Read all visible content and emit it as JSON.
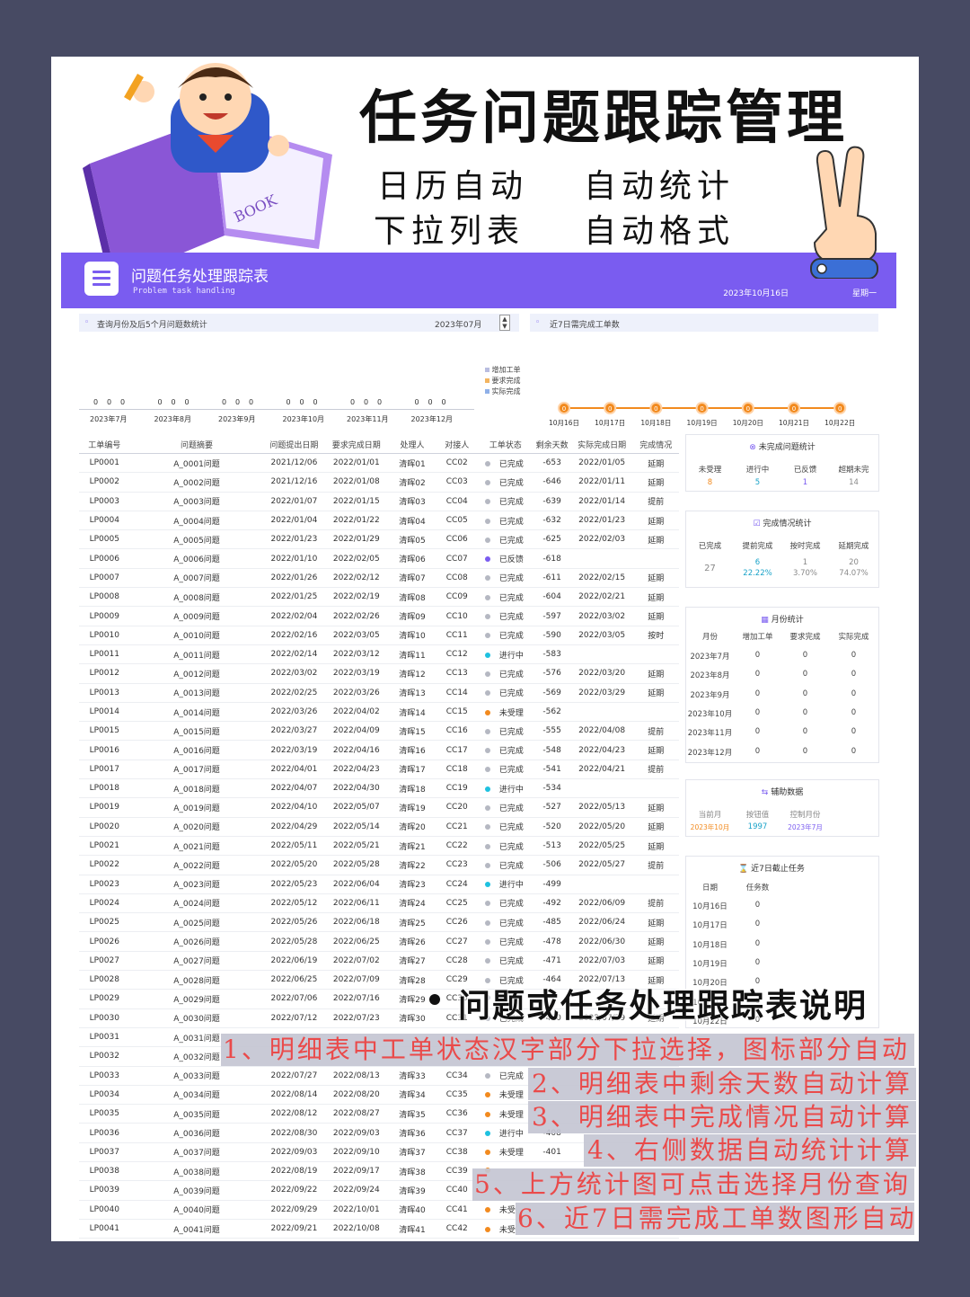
{
  "hero": {
    "title": "任务问题跟踪管理",
    "features": [
      "日历自动",
      "自动统计",
      "下拉列表",
      "自动格式"
    ]
  },
  "banner": {
    "title": "问题任务处理跟踪表",
    "subtitle": "Problem task handling",
    "date": "2023年10月16日",
    "weekday": "星期一"
  },
  "query": {
    "label": "查询月份及后5个月问题数统计",
    "month_value": "2023年07月",
    "next7_label": "近7日需完成工单数"
  },
  "legend": [
    "增加工单",
    "要求完成",
    "实际完成"
  ],
  "month_chart": {
    "months": [
      "2023年7月",
      "2023年8月",
      "2023年9月",
      "2023年10月",
      "2023年11月",
      "2023年12月"
    ],
    "values": [
      [
        0,
        0,
        0
      ],
      [
        0,
        0,
        0
      ],
      [
        0,
        0,
        0
      ],
      [
        0,
        0,
        0
      ],
      [
        0,
        0,
        0
      ],
      [
        0,
        0,
        0
      ]
    ]
  },
  "chart_data": {
    "type": "line",
    "categories": [
      "10月16日",
      "10月17日",
      "10月18日",
      "10月19日",
      "10月20日",
      "10月21日",
      "10月22日"
    ],
    "values": [
      0,
      0,
      0,
      0,
      0,
      0,
      0
    ]
  },
  "colors": {
    "purple": "#7a5cf0",
    "orange": "#f28a1e",
    "note_red": "#ea4a4a"
  },
  "table": {
    "headers": [
      "工单编号",
      "问题摘要",
      "问题提出日期",
      "要求完成日期",
      "处理人",
      "对接人",
      "工单状态",
      "剩余天数",
      "实际完成日期",
      "完成情况"
    ],
    "rows": [
      [
        "LP0001",
        "A_0001问题",
        "2021/12/06",
        "2022/01/01",
        "清晖01",
        "CC02",
        "gray",
        "已完成",
        "-653",
        "2022/01/05",
        "延期"
      ],
      [
        "LP0002",
        "A_0002问题",
        "2021/12/16",
        "2022/01/08",
        "清晖02",
        "CC03",
        "gray",
        "已完成",
        "-646",
        "2022/01/11",
        "延期"
      ],
      [
        "LP0003",
        "A_0003问题",
        "2022/01/07",
        "2022/01/15",
        "清晖03",
        "CC04",
        "gray",
        "已完成",
        "-639",
        "2022/01/14",
        "提前"
      ],
      [
        "LP0004",
        "A_0004问题",
        "2022/01/04",
        "2022/01/22",
        "清晖04",
        "CC05",
        "gray",
        "已完成",
        "-632",
        "2022/01/23",
        "延期"
      ],
      [
        "LP0005",
        "A_0005问题",
        "2022/01/23",
        "2022/01/29",
        "清晖05",
        "CC06",
        "gray",
        "已完成",
        "-625",
        "2022/02/03",
        "延期"
      ],
      [
        "LP0006",
        "A_0006问题",
        "2022/01/10",
        "2022/02/05",
        "清晖06",
        "CC07",
        "purple",
        "已反馈",
        "-618",
        "",
        ""
      ],
      [
        "LP0007",
        "A_0007问题",
        "2022/01/26",
        "2022/02/12",
        "清晖07",
        "CC08",
        "gray",
        "已完成",
        "-611",
        "2022/02/15",
        "延期"
      ],
      [
        "LP0008",
        "A_0008问题",
        "2022/01/25",
        "2022/02/19",
        "清晖08",
        "CC09",
        "gray",
        "已完成",
        "-604",
        "2022/02/21",
        "延期"
      ],
      [
        "LP0009",
        "A_0009问题",
        "2022/02/04",
        "2022/02/26",
        "清晖09",
        "CC10",
        "gray",
        "已完成",
        "-597",
        "2022/03/02",
        "延期"
      ],
      [
        "LP0010",
        "A_0010问题",
        "2022/02/16",
        "2022/03/05",
        "清晖10",
        "CC11",
        "gray",
        "已完成",
        "-590",
        "2022/03/05",
        "按时"
      ],
      [
        "LP0011",
        "A_0011问题",
        "2022/02/14",
        "2022/03/12",
        "清晖11",
        "CC12",
        "cyan",
        "进行中",
        "-583",
        "",
        ""
      ],
      [
        "LP0012",
        "A_0012问题",
        "2022/03/02",
        "2022/03/19",
        "清晖12",
        "CC13",
        "gray",
        "已完成",
        "-576",
        "2022/03/20",
        "延期"
      ],
      [
        "LP0013",
        "A_0013问题",
        "2022/02/25",
        "2022/03/26",
        "清晖13",
        "CC14",
        "gray",
        "已完成",
        "-569",
        "2022/03/29",
        "延期"
      ],
      [
        "LP0014",
        "A_0014问题",
        "2022/03/26",
        "2022/04/02",
        "清晖14",
        "CC15",
        "orange",
        "未受理",
        "-562",
        "",
        ""
      ],
      [
        "LP0015",
        "A_0015问题",
        "2022/03/27",
        "2022/04/09",
        "清晖15",
        "CC16",
        "gray",
        "已完成",
        "-555",
        "2022/04/08",
        "提前"
      ],
      [
        "LP0016",
        "A_0016问题",
        "2022/03/19",
        "2022/04/16",
        "清晖16",
        "CC17",
        "gray",
        "已完成",
        "-548",
        "2022/04/23",
        "延期"
      ],
      [
        "LP0017",
        "A_0017问题",
        "2022/04/01",
        "2022/04/23",
        "清晖17",
        "CC18",
        "gray",
        "已完成",
        "-541",
        "2022/04/21",
        "提前"
      ],
      [
        "LP0018",
        "A_0018问题",
        "2022/04/07",
        "2022/04/30",
        "清晖18",
        "CC19",
        "cyan",
        "进行中",
        "-534",
        "",
        ""
      ],
      [
        "LP0019",
        "A_0019问题",
        "2022/04/10",
        "2022/05/07",
        "清晖19",
        "CC20",
        "gray",
        "已完成",
        "-527",
        "2022/05/13",
        "延期"
      ],
      [
        "LP0020",
        "A_0020问题",
        "2022/04/29",
        "2022/05/14",
        "清晖20",
        "CC21",
        "gray",
        "已完成",
        "-520",
        "2022/05/20",
        "延期"
      ],
      [
        "LP0021",
        "A_0021问题",
        "2022/05/11",
        "2022/05/21",
        "清晖21",
        "CC22",
        "gray",
        "已完成",
        "-513",
        "2022/05/25",
        "延期"
      ],
      [
        "LP0022",
        "A_0022问题",
        "2022/05/20",
        "2022/05/28",
        "清晖22",
        "CC23",
        "gray",
        "已完成",
        "-506",
        "2022/05/27",
        "提前"
      ],
      [
        "LP0023",
        "A_0023问题",
        "2022/05/23",
        "2022/06/04",
        "清晖23",
        "CC24",
        "cyan",
        "进行中",
        "-499",
        "",
        ""
      ],
      [
        "LP0024",
        "A_0024问题",
        "2022/05/12",
        "2022/06/11",
        "清晖24",
        "CC25",
        "gray",
        "已完成",
        "-492",
        "2022/06/09",
        "提前"
      ],
      [
        "LP0025",
        "A_0025问题",
        "2022/05/26",
        "2022/06/18",
        "清晖25",
        "CC26",
        "gray",
        "已完成",
        "-485",
        "2022/06/24",
        "延期"
      ],
      [
        "LP0026",
        "A_0026问题",
        "2022/05/28",
        "2022/06/25",
        "清晖26",
        "CC27",
        "gray",
        "已完成",
        "-478",
        "2022/06/30",
        "延期"
      ],
      [
        "LP0027",
        "A_0027问题",
        "2022/06/19",
        "2022/07/02",
        "清晖27",
        "CC28",
        "gray",
        "已完成",
        "-471",
        "2022/07/03",
        "延期"
      ],
      [
        "LP0028",
        "A_0028问题",
        "2022/06/25",
        "2022/07/09",
        "清晖28",
        "CC29",
        "gray",
        "已完成",
        "-464",
        "2022/07/13",
        "延期"
      ],
      [
        "LP0029",
        "A_0029问题",
        "2022/07/06",
        "2022/07/16",
        "清晖29",
        "CC30",
        "gray",
        "",
        "",
        "",
        ""
      ],
      [
        "LP0030",
        "A_0030问题",
        "2022/07/12",
        "2022/07/23",
        "清晖30",
        "CC31",
        "gray",
        "已完成",
        "-450",
        "2022/07/29",
        "延期"
      ],
      [
        "LP0031",
        "A_0031问题",
        "",
        "",
        "",
        "",
        "",
        "",
        "",
        "",
        ""
      ],
      [
        "LP0032",
        "A_0032问题",
        "",
        "",
        "",
        "",
        "",
        "",
        "",
        "",
        ""
      ],
      [
        "LP0033",
        "A_0033问题",
        "2022/07/27",
        "2022/08/13",
        "清晖33",
        "CC34",
        "gray",
        "已完成",
        "",
        "",
        ""
      ],
      [
        "LP0034",
        "A_0034问题",
        "2022/08/14",
        "2022/08/20",
        "清晖34",
        "CC35",
        "orange",
        "未受理",
        "",
        "",
        ""
      ],
      [
        "LP0035",
        "A_0035问题",
        "2022/08/12",
        "2022/08/27",
        "清晖35",
        "CC36",
        "orange",
        "未受理",
        "",
        "",
        ""
      ],
      [
        "LP0036",
        "A_0036问题",
        "2022/08/30",
        "2022/09/03",
        "清晖36",
        "CC37",
        "cyan",
        "进行中",
        "-408",
        "",
        ""
      ],
      [
        "LP0037",
        "A_0037问题",
        "2022/09/03",
        "2022/09/10",
        "清晖37",
        "CC38",
        "orange",
        "未受理",
        "-401",
        "",
        ""
      ],
      [
        "LP0038",
        "A_0038问题",
        "2022/08/19",
        "2022/09/17",
        "清晖38",
        "CC39",
        "orange",
        "",
        "",
        "",
        ""
      ],
      [
        "LP0039",
        "A_0039问题",
        "2022/09/22",
        "2022/09/24",
        "清晖39",
        "CC40",
        "",
        "",
        "",
        "",
        ""
      ],
      [
        "LP0040",
        "A_0040问题",
        "2022/09/29",
        "2022/10/01",
        "清晖40",
        "CC41",
        "orange",
        "未受",
        "",
        "",
        ""
      ],
      [
        "LP0041",
        "A_0041问题",
        "2022/09/21",
        "2022/10/08",
        "清晖41",
        "CC42",
        "orange",
        "未受",
        "",
        "",
        ""
      ]
    ]
  },
  "unfinished": {
    "title": "未完成问题统计",
    "labels": [
      "未受理",
      "进行中",
      "已反馈",
      "超期未完"
    ],
    "values": [
      "8",
      "5",
      "1",
      "14"
    ]
  },
  "completion": {
    "title": "完成情况统计",
    "labels": [
      "已完成",
      "提前完成",
      "按时完成",
      "延期完成"
    ],
    "counts": [
      "27",
      "6",
      "1",
      "20"
    ],
    "pcts": [
      "22.22%",
      "3.70%",
      "74.07%"
    ]
  },
  "monthly": {
    "title": "月份统计",
    "headers": [
      "月份",
      "增加工单",
      "要求完成",
      "实际完成"
    ],
    "rows": [
      [
        "2023年7月",
        "0",
        "0",
        "0"
      ],
      [
        "2023年8月",
        "0",
        "0",
        "0"
      ],
      [
        "2023年9月",
        "0",
        "0",
        "0"
      ],
      [
        "2023年10月",
        "0",
        "0",
        "0"
      ],
      [
        "2023年11月",
        "0",
        "0",
        "0"
      ],
      [
        "2023年12月",
        "0",
        "0",
        "0"
      ]
    ]
  },
  "aux": {
    "title": "辅助数据",
    "labels": [
      "当前月",
      "按钮值",
      "控制月份"
    ],
    "values": [
      "2023年10月",
      "1997",
      "2023年7月"
    ]
  },
  "due7": {
    "title": "近7日截止任务",
    "headers": [
      "日期",
      "任务数"
    ],
    "rows": [
      [
        "10月16日",
        "0"
      ],
      [
        "10月17日",
        "0"
      ],
      [
        "10月18日",
        "0"
      ],
      [
        "10月19日",
        "0"
      ],
      [
        "10月20日",
        "0"
      ],
      [
        "10月21日",
        "0"
      ],
      [
        "10月22日",
        "0"
      ]
    ]
  },
  "notes": {
    "title": "问题或任务处理跟踪表说明",
    "items": [
      "1、明细表中工单状态汉字部分下拉选择，图标部分自动",
      "2、明细表中剩余天数自动计算",
      "3、明细表中完成情况自动计算",
      "4、右侧数据自动统计计算",
      "5、上方统计图可点击选择月份查询",
      "6、近7日需完成工单数图形自动"
    ]
  }
}
